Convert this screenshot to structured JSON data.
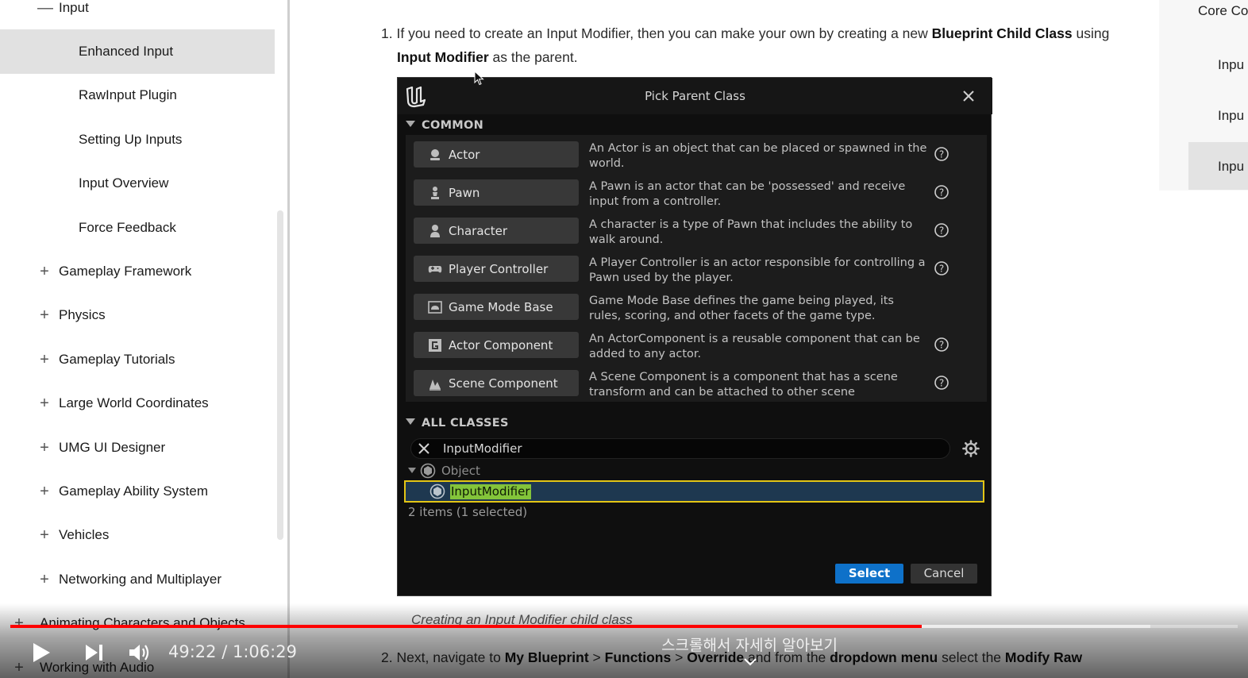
{
  "sidebar": {
    "parent_item": "Input",
    "children": [
      "Enhanced Input",
      "RawInput Plugin",
      "Setting Up Inputs",
      "Input Overview",
      "Force Feedback"
    ],
    "selected_child": "Enhanced Input",
    "sections": [
      "Gameplay Framework",
      "Physics",
      "Gameplay Tutorials",
      "Large World Coordinates",
      "UMG UI Designer",
      "Gameplay Ability System",
      "Vehicles",
      "Networking and Multiplayer",
      "Animating Characters and Objects",
      "Working with Audio"
    ],
    "expand_symbol": "+",
    "collapse_symbol": "—"
  },
  "toc": {
    "items": [
      "Core Co",
      "Inpu",
      "Inpu",
      "Inpu"
    ]
  },
  "article": {
    "step1": {
      "number": "1.",
      "text_a": "If you need to create an Input Modifier, then you can make your own by creating a new ",
      "bold_a": "Blueprint Child Class",
      "text_b": " using",
      "bold_b": "Input Modifier",
      "text_c": " as the parent."
    },
    "caption": "Creating an Input Modifier child class",
    "step2": {
      "number": "2.",
      "text_a": "Next, navigate to ",
      "bold_a": "My Blueprint",
      "sep1": " > ",
      "bold_b": "Functions",
      "sep2": " > ",
      "bold_c": "Override",
      "text_b": " and from the ",
      "bold_d": "dropdown menu",
      "text_c": " select the ",
      "bold_e": "Modify Raw"
    }
  },
  "dialog": {
    "title": "Pick Parent Class",
    "common_header": "COMMON",
    "classes": [
      {
        "name": "Actor",
        "icon": "actor-icon",
        "desc": "An Actor is an object that can be placed or spawned in the world.",
        "help": true
      },
      {
        "name": "Pawn",
        "icon": "pawn-icon",
        "desc": "A Pawn is an actor that can be 'possessed' and receive input from a controller.",
        "help": true
      },
      {
        "name": "Character",
        "icon": "character-icon",
        "desc": "A character is a type of Pawn that includes the ability to walk around.",
        "help": true
      },
      {
        "name": "Player Controller",
        "icon": "gamepad-icon",
        "desc": "A Player Controller is an actor responsible for controlling a Pawn used by the player.",
        "help": true
      },
      {
        "name": "Game Mode Base",
        "icon": "game-mode-icon",
        "desc": "Game Mode Base defines the game being played, its rules, scoring, and other facets of the game type.",
        "help": false
      },
      {
        "name": "Actor Component",
        "icon": "actor-component-icon",
        "desc": "An ActorComponent is a reusable component that can be added to any actor.",
        "help": true
      },
      {
        "name": "Scene Component",
        "icon": "scene-component-icon",
        "desc": "A Scene Component is a component that has a scene transform and can be attached to other scene",
        "help": true
      }
    ],
    "all_classes_header": "ALL CLASSES",
    "search_value": "InputModifier",
    "tree_parent": "Object",
    "tree_selected": "InputModifier",
    "items_status": "2 items (1 selected)",
    "select_label": "Select",
    "cancel_label": "Cancel",
    "accent_color": "#0e71c9",
    "highlight_color": "#83c43a",
    "selection_border_color": "#e3c515"
  },
  "player": {
    "time_current": "49:22",
    "time_separator": " / ",
    "time_total": "1:06:29",
    "progress_fraction": 0.7425,
    "buffer_fraction": 0.929,
    "subtitle": "스크롤해서 자세히 알아보기",
    "progress_color": "#ff0000"
  }
}
